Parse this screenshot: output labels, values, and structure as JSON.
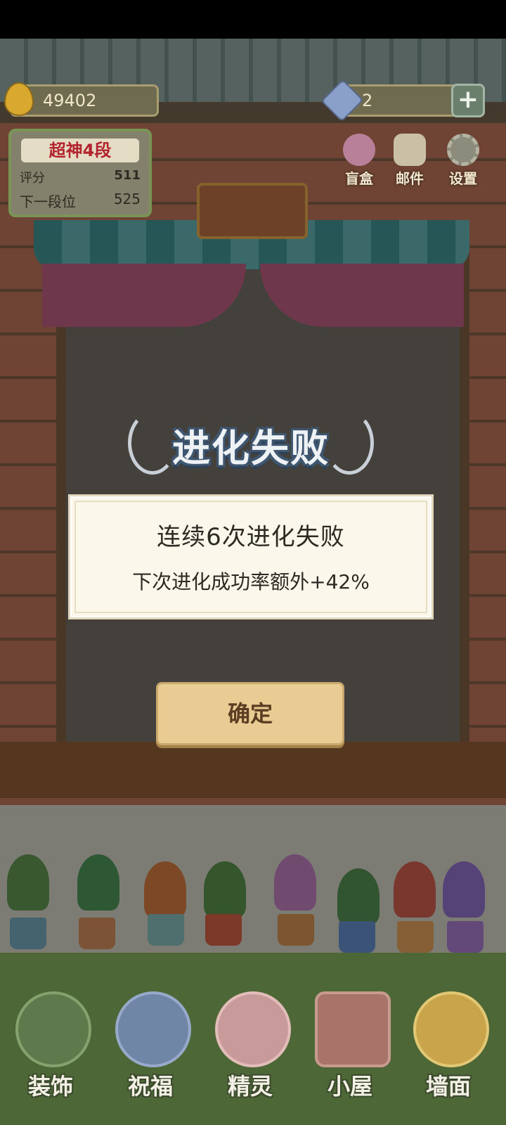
{
  "hud": {
    "coins": "49402",
    "gems": "2",
    "plus_label": "+"
  },
  "rank": {
    "title": "超神4段",
    "score_label": "评分",
    "score_value": "511",
    "next_label": "下一段位",
    "next_value": "525"
  },
  "top_buttons": [
    {
      "label": "盲盒",
      "icon": "gift-box-icon"
    },
    {
      "label": "邮件",
      "icon": "mail-icon"
    },
    {
      "label": "设置",
      "icon": "gear-icon"
    }
  ],
  "dialog": {
    "title": "进化失败",
    "message": "连续6次进化失败",
    "detail": "下次进化成功率额外+42%",
    "confirm_label": "确定"
  },
  "bottom_nav": [
    {
      "label": "装饰",
      "icon": "plant-icon"
    },
    {
      "label": "祝福",
      "icon": "butterfly-icon"
    },
    {
      "label": "精灵",
      "icon": "fairy-icon"
    },
    {
      "label": "小屋",
      "icon": "house-icon"
    },
    {
      "label": "墙面",
      "icon": "bell-icon"
    }
  ],
  "colors": {
    "rank_title": "#b3232d",
    "confirm_button": "#e8cc93",
    "dialog_bg": "#fbf7ea"
  }
}
